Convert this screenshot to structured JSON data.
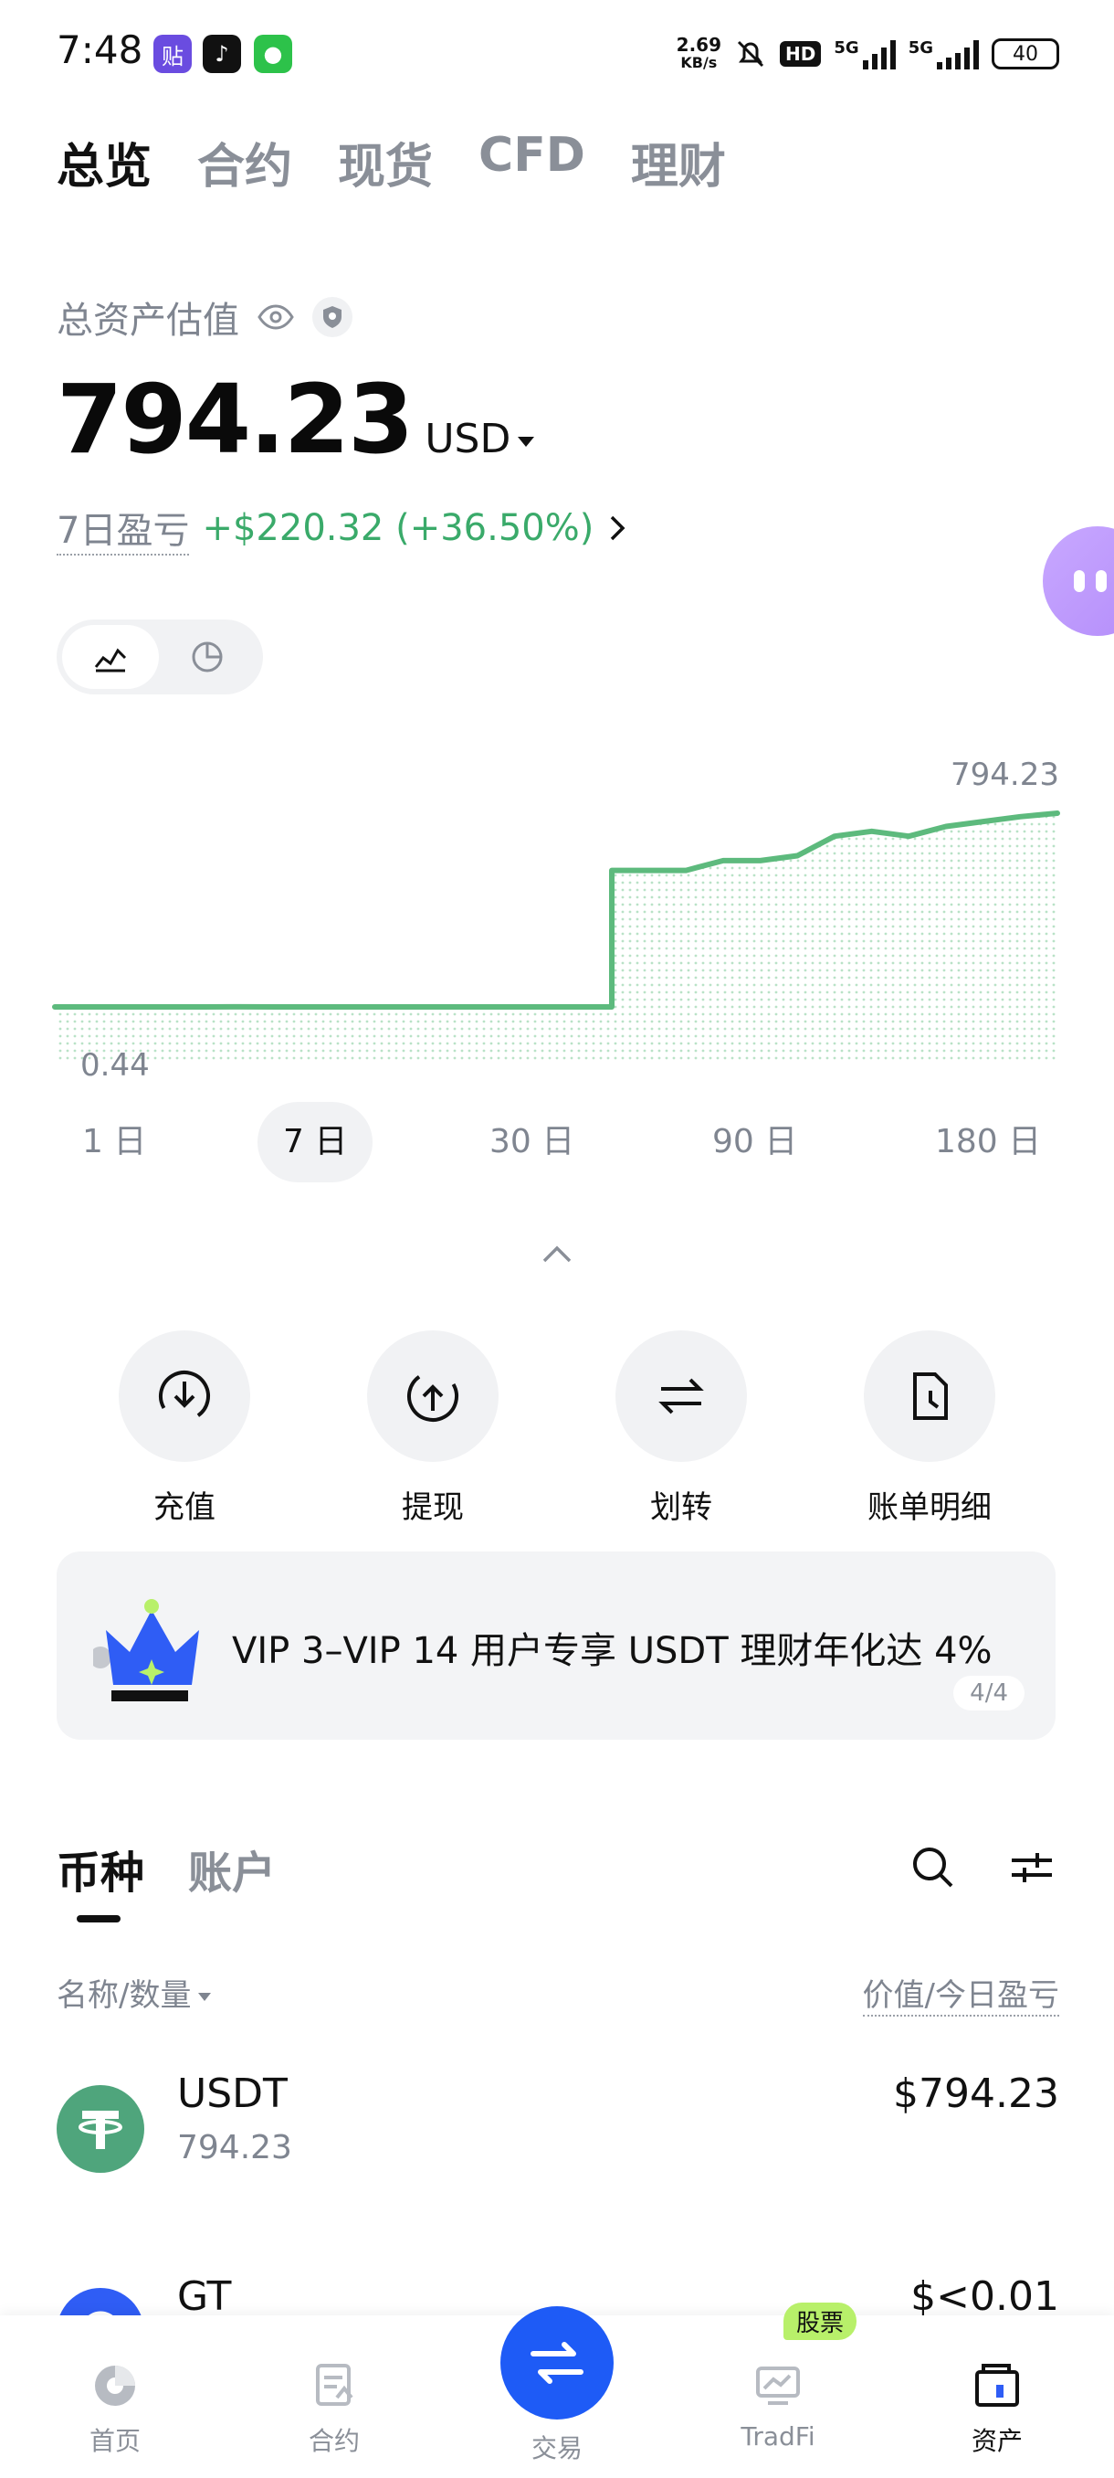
{
  "status_bar": {
    "time": "7:48",
    "speed_value": "2.69",
    "speed_unit": "KB/s",
    "hd": "HD",
    "net1": "5G",
    "net2": "5G",
    "battery": "40"
  },
  "top_tabs": [
    "总览",
    "合约",
    "现货",
    "CFD",
    "理财"
  ],
  "active_top_tab": "总览",
  "assets": {
    "label": "总资产估值",
    "balance": "794.23",
    "currency": "USD",
    "pnl_label": "7日盈亏",
    "pnl_value": "+$220.32 (+36.50%)"
  },
  "chart_data": {
    "type": "area",
    "max_label": "794.23",
    "min_label": "0.44",
    "ranges": [
      "1 日",
      "7 日",
      "30 日",
      "90 日",
      "180 日"
    ],
    "active_range": "7 日",
    "values": [
      0.44,
      0.44,
      0.5,
      0.48,
      0.6,
      0.9,
      0.5,
      0.46,
      0.46,
      0.45,
      0.46,
      0.48,
      0.5,
      0.52,
      0.52,
      560,
      560,
      560,
      600,
      600,
      620,
      700,
      720,
      700,
      740,
      760,
      780,
      794.23
    ],
    "line_color": "#5dba7d"
  },
  "actions": [
    {
      "label": "充值",
      "icon": "deposit-icon"
    },
    {
      "label": "提现",
      "icon": "withdraw-icon"
    },
    {
      "label": "划转",
      "icon": "transfer-icon"
    },
    {
      "label": "账单明细",
      "icon": "bill-icon"
    }
  ],
  "banner": {
    "text": "VIP 3–VIP 14 用户专享 USDT 理财年化达 4%",
    "page": "4/4"
  },
  "coin_tabs": [
    "币种",
    "账户"
  ],
  "list_header": {
    "left": "名称/数量",
    "right": "价值/今日盈亏"
  },
  "coins": [
    {
      "name": "USDT",
      "qty": "794.23",
      "value": "$794.23",
      "color": "#4fa57c",
      "symbol": "T"
    },
    {
      "name": "GT",
      "qty": "",
      "value": "$<0.01",
      "color": "#2f5df5",
      "symbol": "G"
    }
  ],
  "bottom_nav": {
    "items": [
      "首页",
      "合约",
      "交易",
      "TradFi",
      "资产"
    ],
    "badge": "股票",
    "active": "资产"
  }
}
